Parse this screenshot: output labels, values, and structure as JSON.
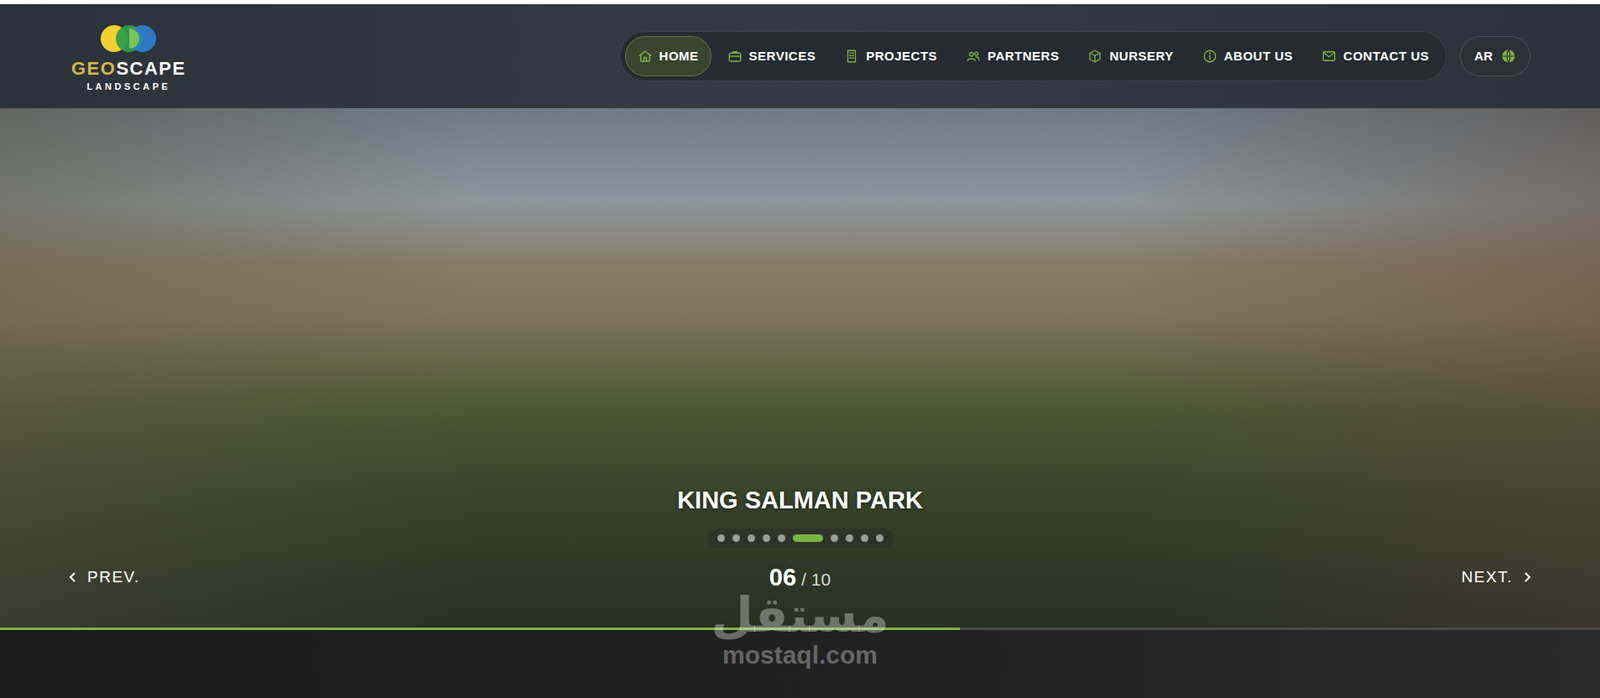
{
  "logo": {
    "geo": "GEO",
    "scape": "SCAPE",
    "sub": "LANDSCAPE"
  },
  "nav": {
    "items": [
      {
        "label": "HOME",
        "selected": true
      },
      {
        "label": "SERVICES",
        "selected": false
      },
      {
        "label": "PROJECTS",
        "selected": false
      },
      {
        "label": "PARTNERS",
        "selected": false
      },
      {
        "label": "NURSERY",
        "selected": false
      },
      {
        "label": "ABOUT US",
        "selected": false
      },
      {
        "label": "CONTACT US",
        "selected": false
      }
    ]
  },
  "language": {
    "label": "AR"
  },
  "hero": {
    "title": "KING SALMAN PARK",
    "slides": [
      {
        "selected": false
      },
      {
        "selected": false
      },
      {
        "selected": false
      },
      {
        "selected": false
      },
      {
        "selected": false
      },
      {
        "selected": true
      },
      {
        "selected": false
      },
      {
        "selected": false
      },
      {
        "selected": false
      },
      {
        "selected": false
      }
    ],
    "counter": {
      "current": "06",
      "total": "/ 10"
    },
    "prev": "PREV.",
    "next": "NEXT.",
    "progress": {
      "level": 0.6
    }
  },
  "watermark": {
    "arabic": "مستقل",
    "latin": "mostaql.com"
  }
}
